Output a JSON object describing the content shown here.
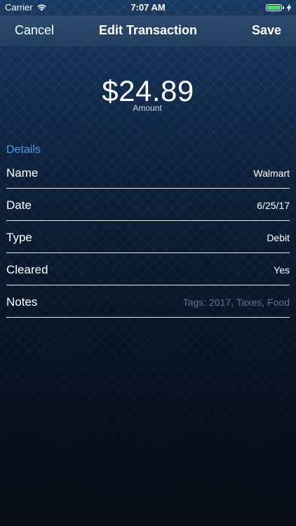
{
  "status_bar": {
    "carrier": "Carrier",
    "time": "7:07 AM",
    "battery_level": 1.0,
    "battery_color": "#4cd964",
    "signal_icon": "wifi-icon",
    "charging_icon": "bolt-icon"
  },
  "nav": {
    "cancel_label": "Cancel",
    "title": "Edit Transaction",
    "save_label": "Save"
  },
  "amount": {
    "value": "$24.89",
    "label": "Amount"
  },
  "details": {
    "header": "Details",
    "accent_color": "#4a9be8",
    "rows": [
      {
        "label": "Name",
        "value": "Walmart"
      },
      {
        "label": "Date",
        "value": "6/25/17"
      },
      {
        "label": "Type",
        "value": "Debit"
      },
      {
        "label": "Cleared",
        "value": "Yes"
      },
      {
        "label": "Notes",
        "placeholder": "Tags: 2017, Taxes, Food"
      }
    ]
  }
}
